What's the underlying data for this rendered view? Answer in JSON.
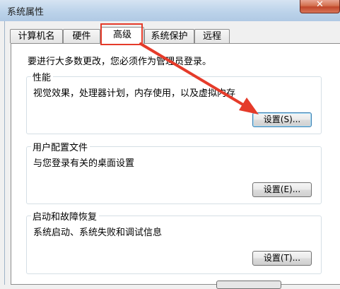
{
  "window": {
    "title": "系统属性",
    "close_label": "✕"
  },
  "tabs": [
    {
      "label": "计算机名"
    },
    {
      "label": "硬件"
    },
    {
      "label": "高级",
      "active": true
    },
    {
      "label": "系统保护"
    },
    {
      "label": "远程"
    }
  ],
  "admin_note": "要进行大多数更改，您必须作为管理员登录。",
  "groups": {
    "performance": {
      "title": "性能",
      "description": "视觉效果，处理器计划，内存使用，以及虚拟内存",
      "button": "设置(S)..."
    },
    "user_profiles": {
      "title": "用户配置文件",
      "description": "与您登录有关的桌面设置",
      "button": "设置(E)..."
    },
    "startup_recovery": {
      "title": "启动和故障恢复",
      "description": "系统启动、系统失败和调试信息",
      "button": "设置(T)..."
    }
  },
  "annotation": {
    "color": "#e53b2a",
    "shape": "arrow",
    "highlight_color": "#e53b2a"
  }
}
